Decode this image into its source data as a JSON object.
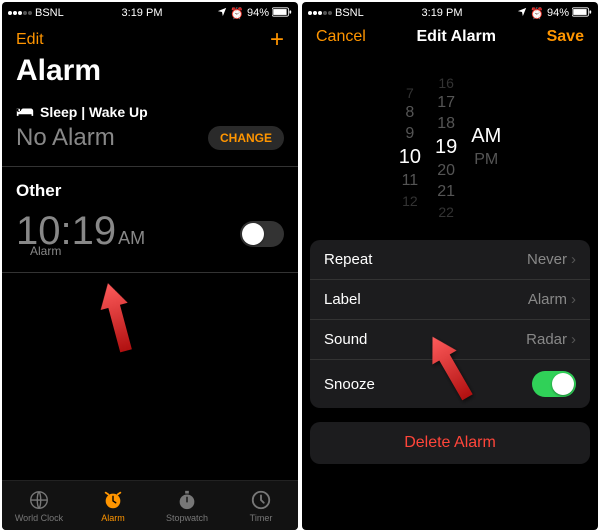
{
  "status": {
    "carrier": "BSNL",
    "time": "3:19 PM",
    "battery": "94%"
  },
  "left": {
    "edit": "Edit",
    "title": "Alarm",
    "sleep_header": "Sleep | Wake Up",
    "no_alarm": "No Alarm",
    "change": "CHANGE",
    "other": "Other",
    "time_hhmm": "10:19",
    "time_ampm": "AM",
    "time_label": "Alarm",
    "tabs": {
      "world_clock": "World Clock",
      "alarm": "Alarm",
      "stopwatch": "Stopwatch",
      "timer": "Timer"
    }
  },
  "right": {
    "cancel": "Cancel",
    "title": "Edit Alarm",
    "save": "Save",
    "picker": {
      "hours": [
        "7",
        "8",
        "9",
        "10",
        "11",
        "12"
      ],
      "mins": [
        "16",
        "17",
        "18",
        "19",
        "20",
        "21",
        "22"
      ],
      "ampm": [
        "AM",
        "PM"
      ]
    },
    "rows": {
      "repeat_label": "Repeat",
      "repeat_val": "Never",
      "label_label": "Label",
      "label_val": "Alarm",
      "sound_label": "Sound",
      "sound_val": "Radar",
      "snooze_label": "Snooze"
    },
    "delete": "Delete Alarm"
  }
}
